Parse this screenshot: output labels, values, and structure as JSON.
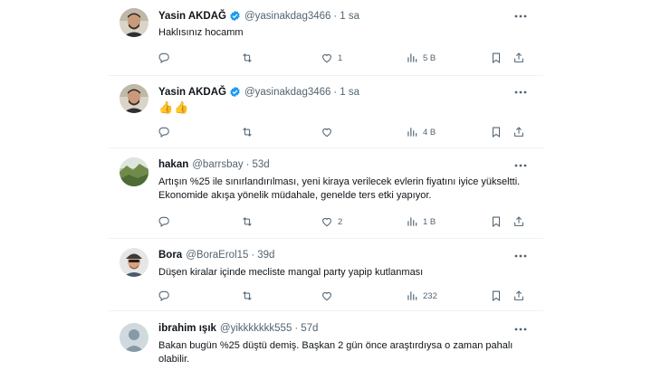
{
  "tweets": [
    {
      "name": "Yasin AKDAĞ",
      "verified": true,
      "handle": "@yasinakdag3466",
      "time": "1 sa",
      "text": "Haklısınız hocamm",
      "replies": "",
      "retweets": "",
      "likes": "1",
      "views": "5 B",
      "avatar": "man-photo"
    },
    {
      "name": "Yasin AKDAĞ",
      "verified": true,
      "handle": "@yasinakdag3466",
      "time": "1 sa",
      "text": "👍👍",
      "replies": "",
      "retweets": "",
      "likes": "",
      "views": "4 B",
      "avatar": "man-photo"
    },
    {
      "name": "hakan",
      "verified": false,
      "handle": "@barrsbay",
      "time": "53d",
      "text": "Artışın %25 ile sınırlandırılması, yeni kiraya verilecek evlerin fiyatını iyice yükseltti. Ekonomide akışa yönelik müdahale, genelde ters etki yapıyor.",
      "replies": "",
      "retweets": "",
      "likes": "2",
      "views": "1 B",
      "avatar": "landscape-photo"
    },
    {
      "name": "Bora",
      "verified": false,
      "handle": "@BoraErol15",
      "time": "39d",
      "text": "Düşen kiralar içinde mecliste mangal party yapip kutlanması",
      "replies": "",
      "retweets": "",
      "likes": "",
      "views": "232",
      "avatar": "man-cap-photo"
    },
    {
      "name": "ibrahim ışık",
      "verified": false,
      "handle": "@yikkkkkkk555",
      "time": "57d",
      "text": "Bakan bugün %25 düştü demiş. Başkan 2 gün önce araştırdıysa o zaman pahalı olabilir.",
      "replies": "",
      "retweets": "",
      "likes": "",
      "views": "",
      "avatar": "default-avatar"
    }
  ],
  "separator_dot": "·",
  "colors": {
    "verified": "#1d9bf0",
    "muted": "#536471",
    "text": "#0f1419",
    "divider": "#eff3f4"
  }
}
